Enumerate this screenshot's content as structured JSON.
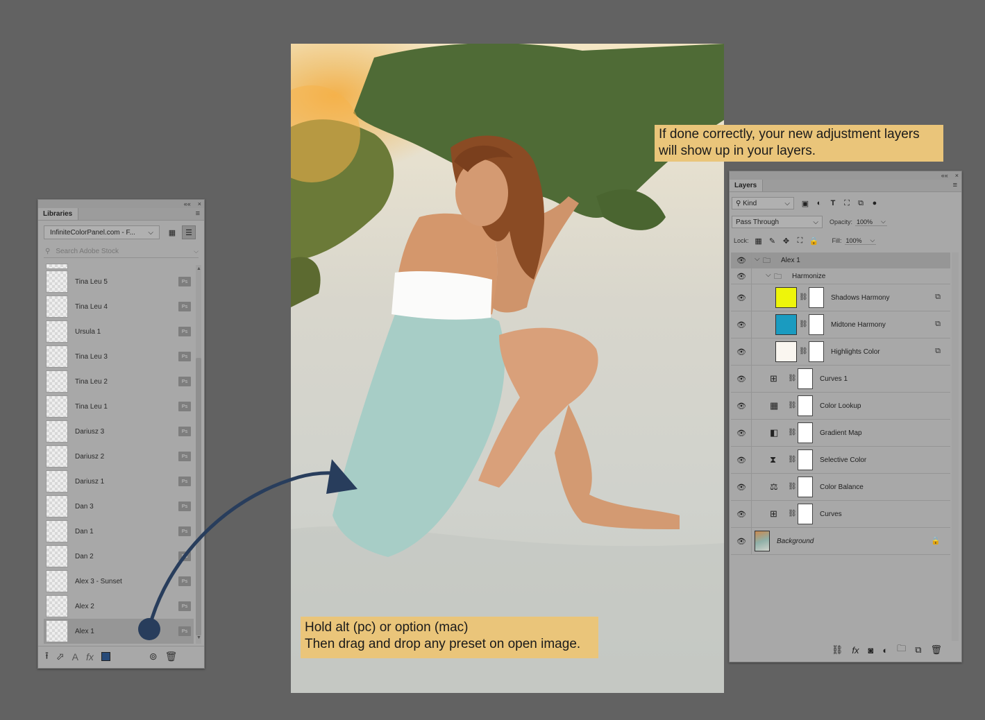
{
  "libraries": {
    "tab": "Libraries",
    "collapse": "««",
    "close": "×",
    "menu": "≡",
    "library_name": "InfiniteColorPanel.com - F...",
    "search_placeholder": "Search Adobe Stock",
    "badge": "Ps",
    "items": [
      "Tina Leu 5",
      "Tina Leu 4",
      "Ursula 1",
      "Tina Leu 3",
      "Tina Leu 2",
      "Tina Leu 1",
      "Dariusz 3",
      "Dariusz 2",
      "Dariusz 1",
      "Dan 3",
      "Dan 1",
      "Dan 2",
      "Alex 3 - Sunset",
      "Alex 2",
      "Alex 1"
    ],
    "selected_index": 14,
    "text_icon": "A",
    "fx_icon": "fx",
    "swatch_color": "#274a78"
  },
  "callouts": {
    "top_line1": "If done correctly, your new adjustment layers",
    "top_line2": "will show up in your layers.",
    "bottom_line1": "Hold alt (pc) or option (mac)",
    "bottom_line2": "Then drag and drop any preset on open image."
  },
  "layers": {
    "tab": "Layers",
    "collapse": "««",
    "close": "×",
    "menu": "≡",
    "filter_kind": "Kind",
    "blend_mode": "Pass Through",
    "opacity_label": "Opacity:",
    "opacity_value": "100%",
    "lock_label": "Lock:",
    "fill_label": "Fill:",
    "fill_value": "100%",
    "fx_icon": "fx",
    "rows": [
      {
        "name": "Alex 1",
        "kind": "group"
      },
      {
        "name": "Harmonize",
        "kind": "subgroup"
      },
      {
        "name": "Shadows Harmony",
        "kind": "fill",
        "color": "#eef50a"
      },
      {
        "name": "Midtone Harmony",
        "kind": "fill",
        "color": "#1a9bc0"
      },
      {
        "name": "Highlights Color",
        "kind": "fill",
        "color": "#faf6f0"
      },
      {
        "name": "Curves 1",
        "kind": "curves"
      },
      {
        "name": "Color Lookup",
        "kind": "lookup"
      },
      {
        "name": "Gradient Map",
        "kind": "gradient"
      },
      {
        "name": "Selective Color",
        "kind": "selective"
      },
      {
        "name": "Color Balance",
        "kind": "balance"
      },
      {
        "name": "Curves",
        "kind": "curves"
      },
      {
        "name": "Background",
        "kind": "background"
      }
    ]
  }
}
